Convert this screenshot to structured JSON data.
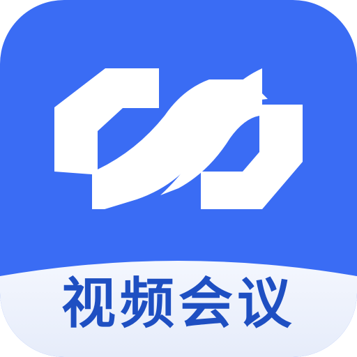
{
  "app": {
    "label": "视频会议",
    "logo_icon": "link-loop-icon"
  },
  "colors": {
    "primary": "#3A6CF4",
    "bottom_panel": "#EEF2FC",
    "text": "#1E4FC2",
    "logo_fill": "#FFFFFF"
  }
}
